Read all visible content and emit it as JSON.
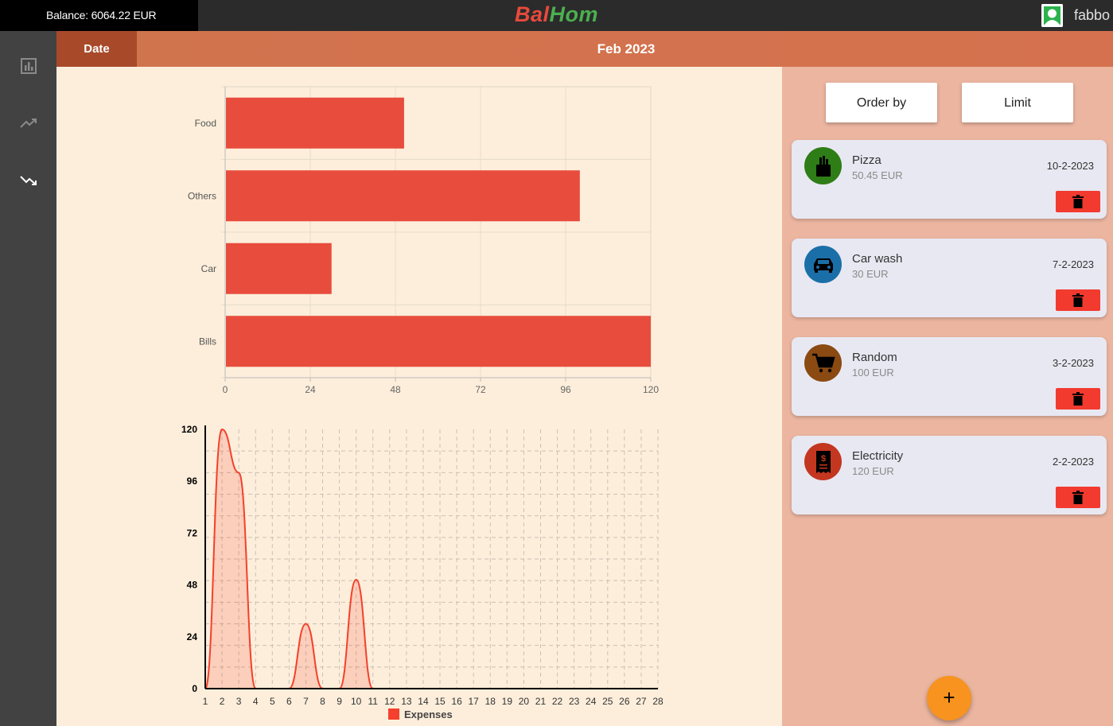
{
  "topbar": {
    "balance": "Balance: 6064.22 EUR",
    "logo_part1": "Bal",
    "logo_part2": "Hom",
    "username": "fabbo"
  },
  "sidebar": {
    "items": [
      {
        "icon": "bar-chart-icon"
      },
      {
        "icon": "trending-up-icon"
      },
      {
        "icon": "trending-down-icon",
        "active": true
      }
    ]
  },
  "header": {
    "date_tab": "Date",
    "period": "Feb 2023"
  },
  "controls": {
    "order_by": "Order by",
    "limit": "Limit"
  },
  "expenses": [
    {
      "name": "Pizza",
      "amount": "50.45 EUR",
      "date": "10-2-2023",
      "icon": "grocery-bag-icon",
      "icon_color": "#2e7d17"
    },
    {
      "name": "Car wash",
      "amount": "30 EUR",
      "date": "7-2-2023",
      "icon": "car-icon",
      "icon_color": "#1b6fa8"
    },
    {
      "name": "Random",
      "amount": "100 EUR",
      "date": "3-2-2023",
      "icon": "shopping-cart-icon",
      "icon_color": "#8a4a12"
    },
    {
      "name": "Electricity",
      "amount": "120 EUR",
      "date": "2-2-2023",
      "icon": "receipt-icon",
      "icon_color": "#c3361f"
    }
  ],
  "fab": {
    "label": "+"
  },
  "chart_data": [
    {
      "type": "bar",
      "orientation": "horizontal",
      "categories": [
        "Food",
        "Others",
        "Car",
        "Bills"
      ],
      "values": [
        50.45,
        100,
        30,
        120
      ],
      "xlim": [
        0,
        120
      ],
      "xticks": [
        "0",
        "24",
        "48",
        "72",
        "96",
        "120"
      ],
      "grid": true,
      "color": "#e84c3d"
    },
    {
      "type": "area",
      "x": [
        1,
        2,
        3,
        4,
        5,
        6,
        7,
        8,
        9,
        10,
        11,
        12,
        13,
        14,
        15,
        16,
        17,
        18,
        19,
        20,
        21,
        22,
        23,
        24,
        25,
        26,
        27,
        28
      ],
      "series": [
        {
          "name": "Expenses",
          "values": [
            0,
            120,
            100,
            0,
            0,
            0,
            30,
            0,
            0,
            50.45,
            0,
            0,
            0,
            0,
            0,
            0,
            0,
            0,
            0,
            0,
            0,
            0,
            0,
            0,
            0,
            0,
            0,
            0
          ]
        }
      ],
      "ylim": [
        0,
        120
      ],
      "yticks": [
        "0",
        "24",
        "48",
        "72",
        "96",
        "120"
      ],
      "grid": true,
      "legend": "bottom",
      "color": "#f4402c"
    }
  ]
}
